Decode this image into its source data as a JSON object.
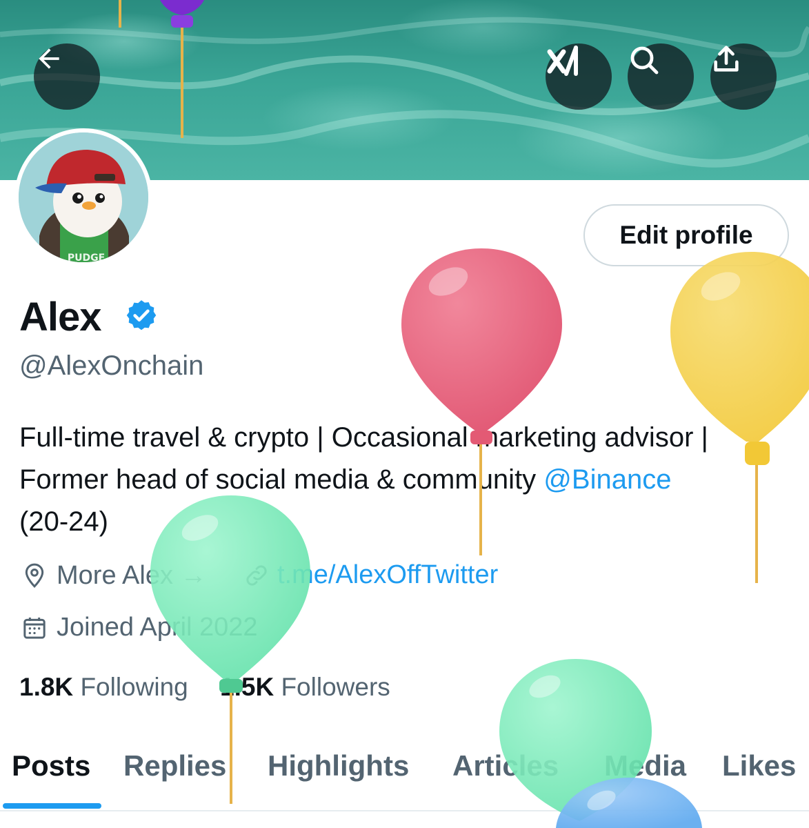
{
  "header": {
    "back_icon": "back-arrow-icon",
    "actions": [
      "grok-icon",
      "search-icon",
      "share-icon"
    ]
  },
  "profile": {
    "name": "Alex",
    "handle": "@AlexOnchain",
    "edit_button": "Edit profile",
    "avatar_text": "PUDGE",
    "bio_line1": "Full-time travel & crypto | Occasional marketing advisor |",
    "bio_line2_prefix": "Former head of social media & community ",
    "bio_mention": "@Binance",
    "bio_line3": "(20-24)",
    "location": "More Alex →",
    "website": "t.me/AlexOffTwitter",
    "joined": "Joined April 2022",
    "following_count": "1.8K",
    "following_label": "Following",
    "followers_count": "1.5K",
    "followers_label": "Followers"
  },
  "tabs": [
    "Posts",
    "Replies",
    "Highlights",
    "Articles",
    "Media",
    "Likes"
  ],
  "active_tab": "Posts",
  "colors": {
    "accent": "#1d9bf0",
    "text": "#0f1419",
    "secondary_text": "#536471",
    "banner": "#3aa596"
  }
}
